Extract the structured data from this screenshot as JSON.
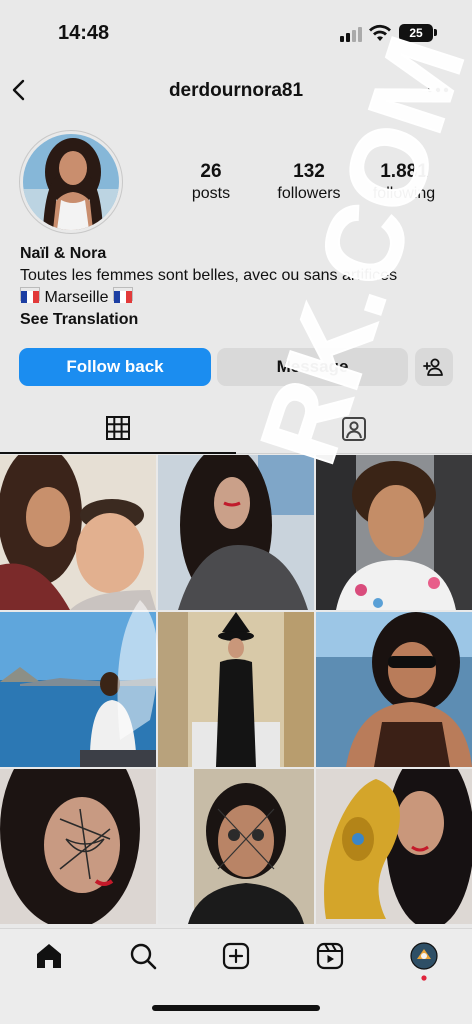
{
  "status_bar": {
    "time": "14:48",
    "battery": "25"
  },
  "header": {
    "username": "derdournora81"
  },
  "profile": {
    "stats": [
      {
        "value": "26",
        "label": "posts"
      },
      {
        "value": "132",
        "label": "followers"
      },
      {
        "value": "1.881",
        "label": "following"
      }
    ],
    "name": "Naïl & Nora",
    "bio_line1": "Toutes les femmes sont belles, avec ou sans artifices",
    "bio_location": "Marseille",
    "see_translation": "See Translation"
  },
  "buttons": {
    "follow_back": "Follow back",
    "message": "Message"
  },
  "tabs": [
    "posts-grid-icon",
    "tagged-icon"
  ],
  "grid_posts": [
    {
      "subject": "woman-and-boy-selfie"
    },
    {
      "subject": "woman-smiling-dark-hair"
    },
    {
      "subject": "woman-in-car"
    },
    {
      "subject": "seaside-sitting"
    },
    {
      "subject": "witch-costume"
    },
    {
      "subject": "woman-sunglasses-sea"
    },
    {
      "subject": "spiderweb-makeup"
    },
    {
      "subject": "halloween-makeup"
    },
    {
      "subject": "gold-balloon"
    }
  ],
  "bottom_nav": [
    "home-icon",
    "search-icon",
    "create-icon",
    "reels-icon",
    "profile-avatar"
  ],
  "colors": {
    "accent": "#1b8df0",
    "background": "#e9e9e9",
    "button_gray": "#d9d9d9"
  },
  "watermark": {
    "text": "RK.COM"
  }
}
